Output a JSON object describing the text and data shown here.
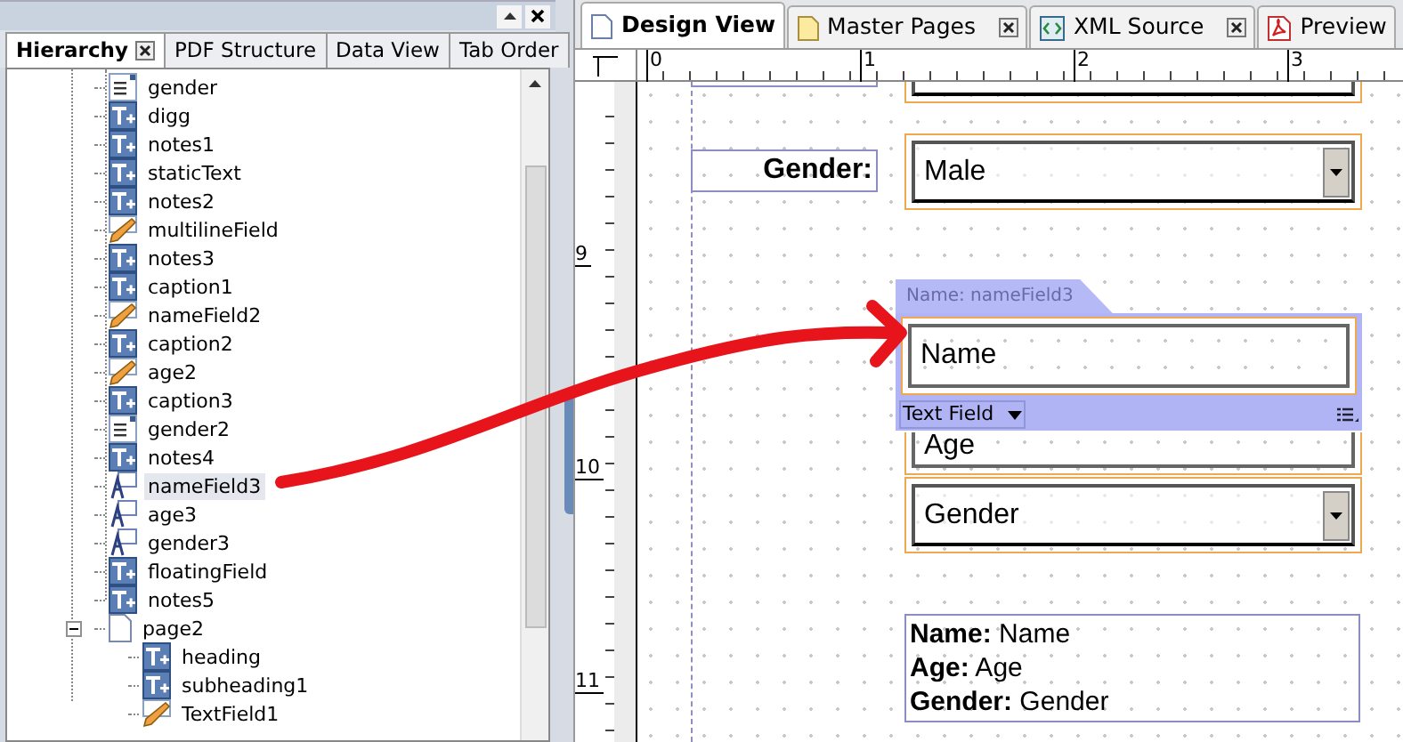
{
  "left_panel": {
    "tabs": [
      {
        "label": "Hierarchy",
        "selected": true,
        "closable": true
      },
      {
        "label": "PDF Structure",
        "selected": false,
        "closable": false
      },
      {
        "label": "Data View",
        "selected": false,
        "closable": false
      },
      {
        "label": "Tab Order",
        "selected": false,
        "closable": false
      }
    ],
    "tree": [
      {
        "kind": "page",
        "children": [
          {
            "label": "gender",
            "kind": "list",
            "selected": false
          },
          {
            "label": "digg",
            "kind": "text",
            "selected": false
          },
          {
            "label": "notes1",
            "kind": "text",
            "selected": false
          },
          {
            "label": "staticText",
            "kind": "text",
            "selected": false
          },
          {
            "label": "notes2",
            "kind": "text",
            "selected": false
          },
          {
            "label": "multilineField",
            "kind": "field",
            "selected": false
          },
          {
            "label": "notes3",
            "kind": "text",
            "selected": false
          },
          {
            "label": "caption1",
            "kind": "text",
            "selected": false
          },
          {
            "label": "nameField2",
            "kind": "field",
            "selected": false
          },
          {
            "label": "caption2",
            "kind": "text",
            "selected": false
          },
          {
            "label": "age2",
            "kind": "field",
            "selected": false
          },
          {
            "label": "caption3",
            "kind": "text",
            "selected": false
          },
          {
            "label": "gender2",
            "kind": "list",
            "selected": false
          },
          {
            "label": "notes4",
            "kind": "text",
            "selected": false
          },
          {
            "label": "nameField3",
            "kind": "floating",
            "selected": true
          },
          {
            "label": "age3",
            "kind": "floating",
            "selected": false
          },
          {
            "label": "gender3",
            "kind": "floating",
            "selected": false
          },
          {
            "label": "floatingField",
            "kind": "text",
            "selected": false
          },
          {
            "label": "notes5",
            "kind": "text",
            "selected": false
          }
        ]
      },
      {
        "label": "page2",
        "kind": "page",
        "expanded": true,
        "selected": false,
        "children": [
          {
            "label": "heading",
            "kind": "text",
            "selected": false
          },
          {
            "label": "subheading1",
            "kind": "text",
            "selected": false
          },
          {
            "label": "TextField1",
            "kind": "field",
            "selected": false
          }
        ]
      }
    ]
  },
  "doc_tabs": [
    {
      "label": "Design View",
      "selected": true,
      "closable": false
    },
    {
      "label": "Master Pages",
      "selected": false,
      "closable": true
    },
    {
      "label": "XML Source",
      "selected": false,
      "closable": true
    },
    {
      "label": "Preview",
      "selected": false,
      "closable": false
    }
  ],
  "ruler": {
    "x_labels": [
      "0",
      "1",
      "2",
      "3"
    ],
    "y_labels": [
      "9",
      "10",
      "11"
    ]
  },
  "canvas": {
    "objects": [
      {
        "kind": "caption",
        "text": "Gender:"
      },
      {
        "kind": "dropdown",
        "value": "Male"
      },
      {
        "kind": "textfield",
        "value": "Name",
        "selected": true,
        "name_tag": "Name: nameField3",
        "type_label": "Text Field"
      },
      {
        "kind": "textfield",
        "value": "Age",
        "selected": false
      },
      {
        "kind": "dropdown",
        "value": "Gender"
      },
      {
        "kind": "summary",
        "lines": [
          "**Name:** Name",
          "**Age:** Age",
          "**Gender:** Gender"
        ]
      }
    ]
  }
}
